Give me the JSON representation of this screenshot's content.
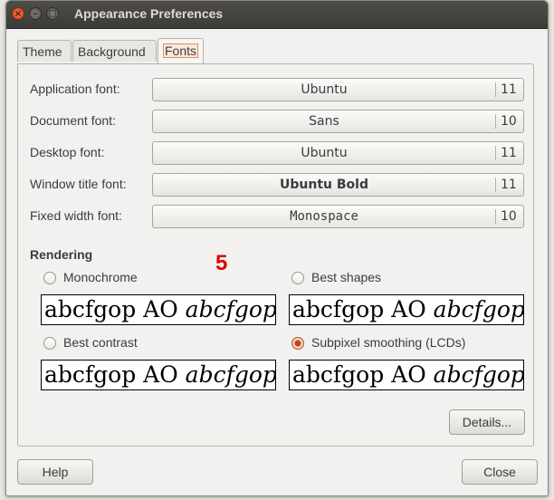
{
  "window": {
    "title": "Appearance Preferences"
  },
  "tabs": [
    {
      "label": "Theme"
    },
    {
      "label": "Background"
    },
    {
      "label": "Fonts"
    }
  ],
  "fonts": [
    {
      "label": "Application font:",
      "name": "Ubuntu",
      "size": "11"
    },
    {
      "label": "Document font:",
      "name": "Sans",
      "size": "10"
    },
    {
      "label": "Desktop font:",
      "name": "Ubuntu",
      "size": "11"
    },
    {
      "label": "Window title font:",
      "name": "Ubuntu Bold",
      "size": "11"
    },
    {
      "label": "Fixed width font:",
      "name": "Monospace",
      "size": "10"
    }
  ],
  "rendering": {
    "title": "Rendering",
    "annotation": "5",
    "options": [
      {
        "label": "Monochrome",
        "checked": false,
        "sample_regular": "abcfgop AO ",
        "sample_italic": "abcfgop"
      },
      {
        "label": "Best shapes",
        "checked": false,
        "sample_regular": "abcfgop AO ",
        "sample_italic": "abcfgop"
      },
      {
        "label": "Best contrast",
        "checked": false,
        "sample_regular": "abcfgop AO ",
        "sample_italic": "abcfgop"
      },
      {
        "label": "Subpixel smoothing (LCDs)",
        "checked": true,
        "sample_regular": "abcfgop AO ",
        "sample_italic": "abcfgop"
      }
    ]
  },
  "buttons": {
    "details": "Details...",
    "help": "Help",
    "close": "Close"
  },
  "colors": {
    "accent": "#e4895a",
    "annotation": "#e00000",
    "titlebar": "#3c3b37"
  }
}
